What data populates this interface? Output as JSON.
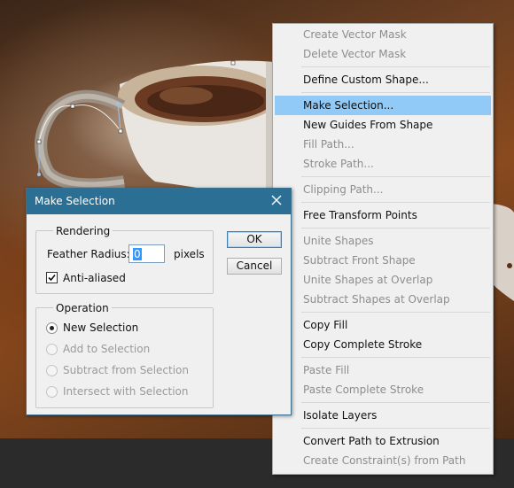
{
  "context_menu": {
    "items": [
      {
        "label": "Create Vector Mask",
        "enabled": false
      },
      {
        "label": "Delete Vector Mask",
        "enabled": false
      },
      {
        "label": "Define Custom Shape...",
        "enabled": true
      },
      {
        "label": "Make Selection...",
        "enabled": true,
        "highlighted": true
      },
      {
        "label": "New Guides From Shape",
        "enabled": true
      },
      {
        "label": "Fill Path...",
        "enabled": false
      },
      {
        "label": "Stroke Path...",
        "enabled": false
      },
      {
        "label": "Clipping Path...",
        "enabled": false
      },
      {
        "label": "Free Transform Points",
        "enabled": true
      },
      {
        "label": "Unite Shapes",
        "enabled": false
      },
      {
        "label": "Subtract Front Shape",
        "enabled": false
      },
      {
        "label": "Unite Shapes at Overlap",
        "enabled": false
      },
      {
        "label": "Subtract Shapes at Overlap",
        "enabled": false
      },
      {
        "label": "Copy Fill",
        "enabled": true
      },
      {
        "label": "Copy Complete Stroke",
        "enabled": true
      },
      {
        "label": "Paste Fill",
        "enabled": false
      },
      {
        "label": "Paste Complete Stroke",
        "enabled": false
      },
      {
        "label": "Isolate Layers",
        "enabled": true
      },
      {
        "label": "Convert Path to Extrusion",
        "enabled": true
      },
      {
        "label": "Create Constraint(s) from Path",
        "enabled": false
      }
    ],
    "highlight_color": "#91c9f7"
  },
  "dialog": {
    "title": "Make Selection",
    "close_icon": "close-icon",
    "titlebar_color": "#2b6f95",
    "rendering": {
      "group_label": "Rendering",
      "feather_label": "Feather Radius:",
      "feather_value": "0",
      "feather_unit": "pixels",
      "anti_aliased_label": "Anti-aliased",
      "anti_aliased_checked": true
    },
    "operation": {
      "group_label": "Operation",
      "options": [
        {
          "label": "New Selection",
          "selected": true,
          "enabled": true
        },
        {
          "label": "Add to Selection",
          "selected": false,
          "enabled": false
        },
        {
          "label": "Subtract from Selection",
          "selected": false,
          "enabled": false
        },
        {
          "label": "Intersect with Selection",
          "selected": false,
          "enabled": false
        }
      ]
    },
    "ok_label": "OK",
    "cancel_label": "Cancel"
  }
}
